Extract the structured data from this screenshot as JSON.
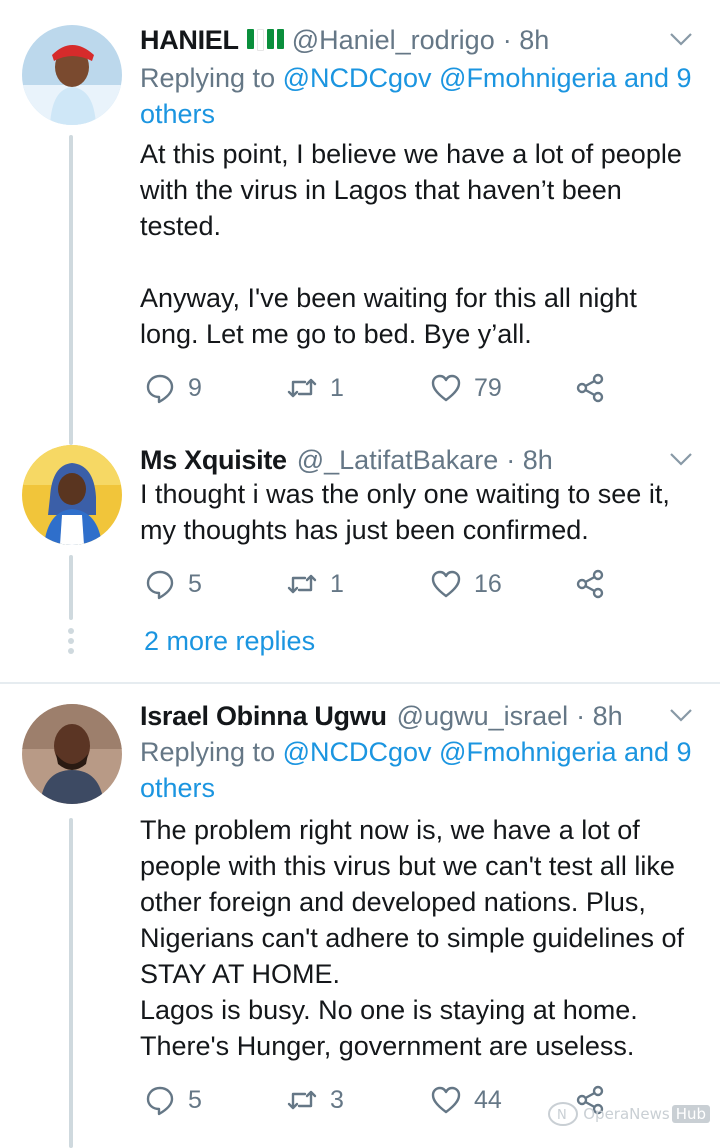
{
  "tweets": [
    {
      "name": "HANIEL",
      "handle": "@Haniel_rodrigo",
      "time": "· 8h",
      "replying_prefix": "Replying to ",
      "replying_line1": "@NCDCgov @Fmohnigeria and 9",
      "replying_line2": "others",
      "body": "At this point, I believe we have a lot of people\nwith the virus in Lagos that haven’t been\ntested.\n\nAnyway, I've been waiting for this all night\nlong. Let me go to bed. Bye y’all.",
      "replies": "9",
      "retweets": "1",
      "likes": "79"
    },
    {
      "name": "Ms Xquisite",
      "handle": "@_LatifatBakare",
      "time": "· 8h",
      "body": "I thought i was the only one waiting to see it,\nmy thoughts has just been confirmed.",
      "replies": "5",
      "retweets": "1",
      "likes": "16"
    },
    {
      "name": "Israel Obinna Ugwu",
      "handle": "@ugwu_israel",
      "time": "· 8h",
      "replying_prefix": "Replying to ",
      "replying_line1": "@NCDCgov @Fmohnigeria and 9",
      "replying_line2": "others",
      "body": "The problem right now is, we have a lot of\npeople with this virus but we can't test all like\nother foreign and developed nations. Plus,\nNigerians can't adhere to simple guidelines of\nSTAY AT HOME.\nLagos is busy. No one is staying at home.\nThere's Hunger, government are useless.",
      "replies": "5",
      "retweets": "3",
      "likes": "44"
    }
  ],
  "more_replies": "2 more replies",
  "watermark": {
    "brand": "OperaNews",
    "suffix": "Hub"
  },
  "colors": {
    "link": "#1b95e0",
    "muted": "#657786",
    "text": "#14171a",
    "flag_green": "#0a8f3c"
  },
  "icons": [
    "reply-icon",
    "retweet-icon",
    "like-icon",
    "share-icon",
    "chevron-down-icon"
  ]
}
